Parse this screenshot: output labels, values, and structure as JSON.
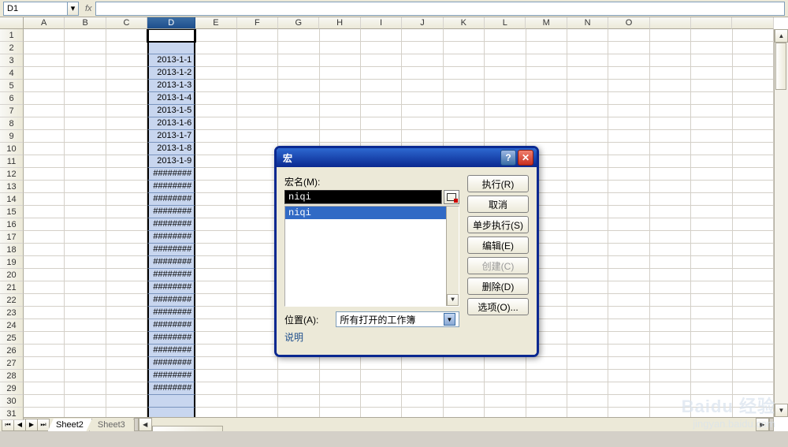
{
  "formula_bar": {
    "name_box": "D1",
    "fx_label": "fx"
  },
  "columns": [
    "A",
    "B",
    "C",
    "D",
    "E",
    "F",
    "G",
    "H",
    "I",
    "J",
    "K",
    "L",
    "M",
    "N",
    "O"
  ],
  "col_header_blank": "",
  "selected_column_index": 3,
  "row_count": 31,
  "cells_col_D": [
    "",
    "",
    "2013-1-1",
    "2013-1-2",
    "2013-1-3",
    "2013-1-4",
    "2013-1-5",
    "2013-1-6",
    "2013-1-7",
    "2013-1-8",
    "2013-1-9",
    "########",
    "########",
    "########",
    "########",
    "########",
    "########",
    "########",
    "########",
    "########",
    "########",
    "########",
    "########",
    "########",
    "########",
    "########",
    "########",
    "########",
    "########",
    ""
  ],
  "sheet_tabs": {
    "active": "Sheet2",
    "inactive": "Sheet3"
  },
  "dialog": {
    "title": "宏",
    "name_label": "宏名(M):",
    "name_value": "niqi",
    "list_item": "niqi",
    "location_label": "位置(A):",
    "location_value": "所有打开的工作簿",
    "description_label": "说明",
    "buttons": {
      "run": "执行(R)",
      "cancel": "取消",
      "step": "单步执行(S)",
      "edit": "编辑(E)",
      "create": "创建(C)",
      "delete": "删除(D)",
      "options": "选项(O)..."
    }
  },
  "watermark": {
    "brand": "Baidu 经验",
    "url": "jingyan.baidu.com"
  }
}
